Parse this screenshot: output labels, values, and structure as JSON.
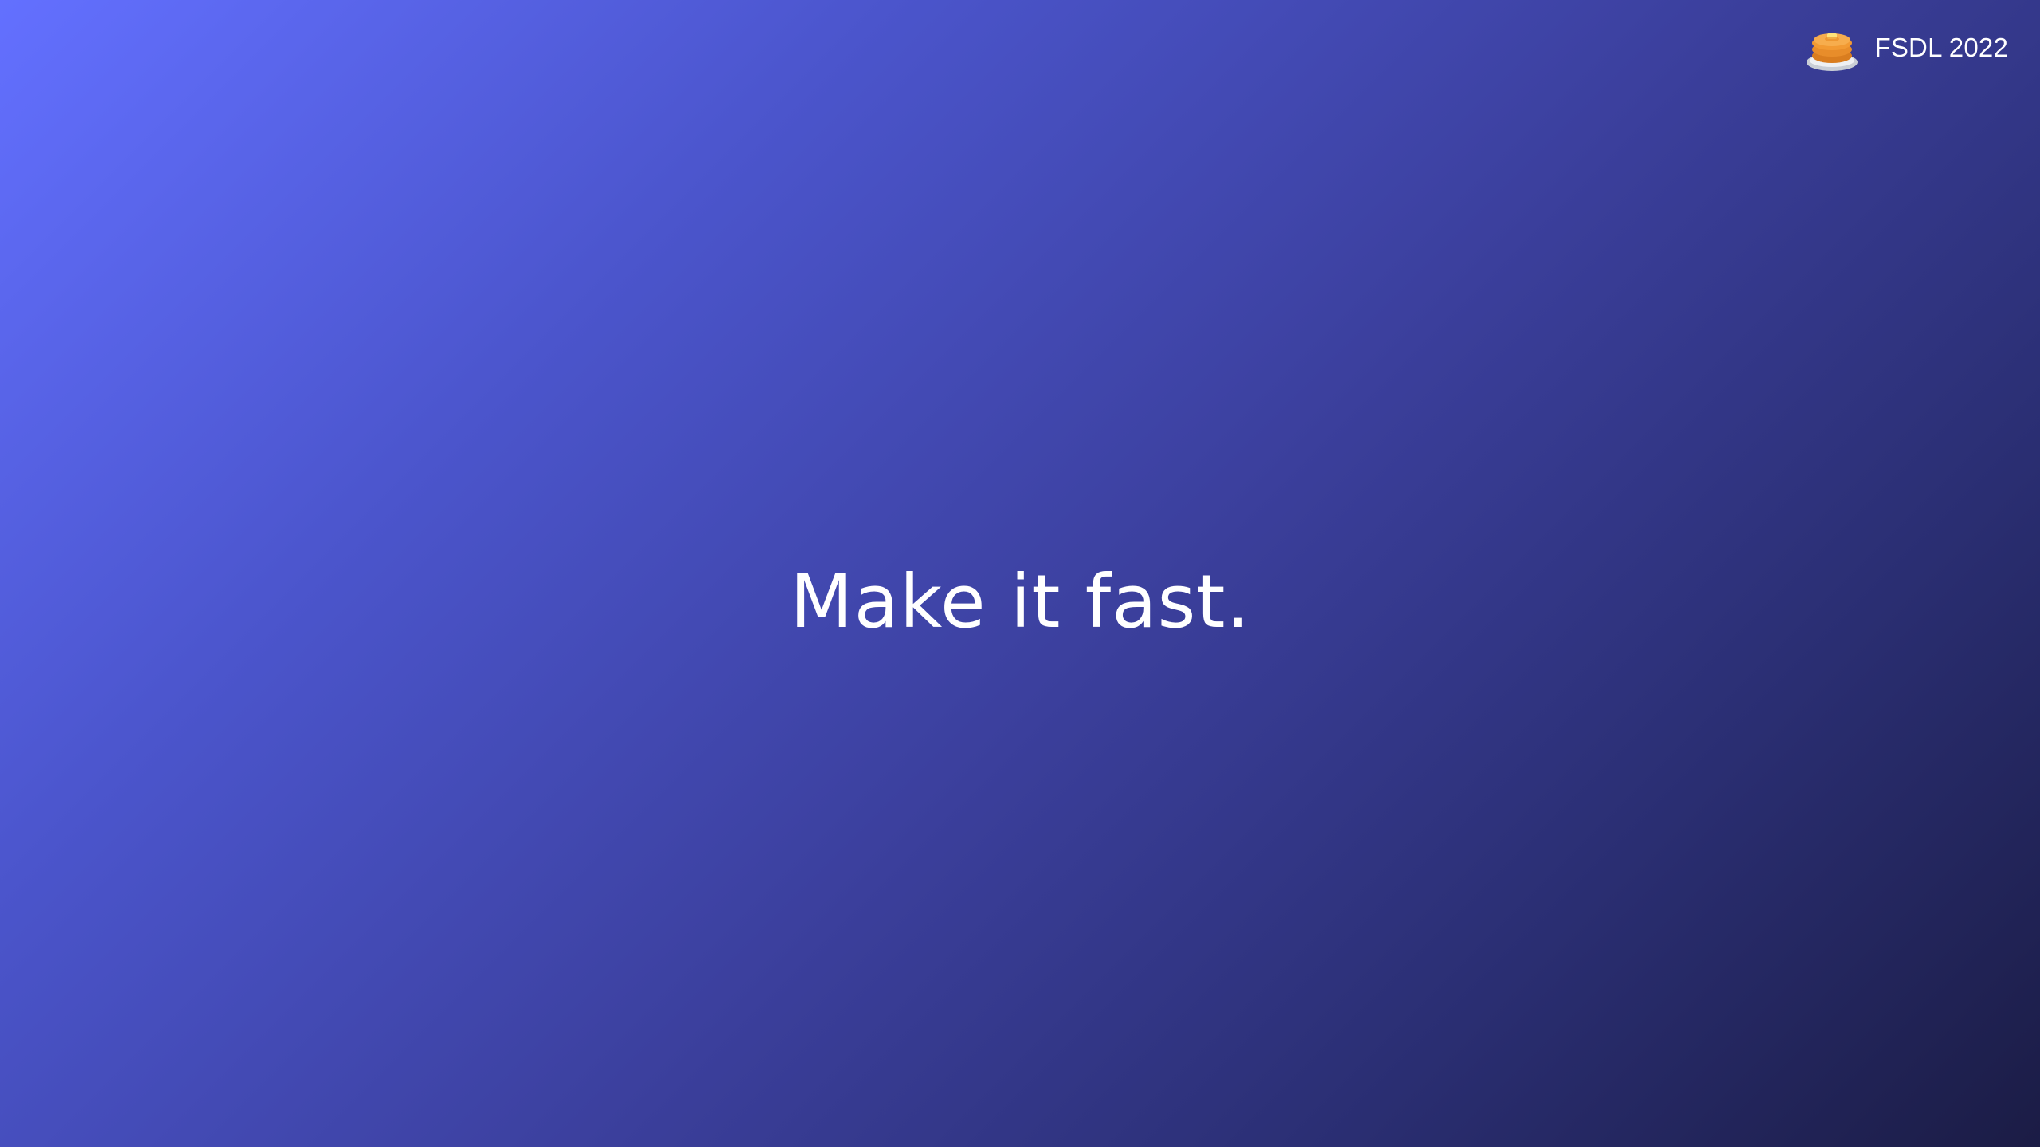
{
  "header": {
    "brand_text": "FSDL 2022",
    "logo_icon": "pancake-icon"
  },
  "main": {
    "headline": "Make it fast."
  },
  "colors": {
    "gradient_start": "#6370ff",
    "gradient_end": "#1b1c45",
    "text": "#ffffff",
    "pancake": "#f4a23a",
    "plate": "#d9dde3"
  }
}
